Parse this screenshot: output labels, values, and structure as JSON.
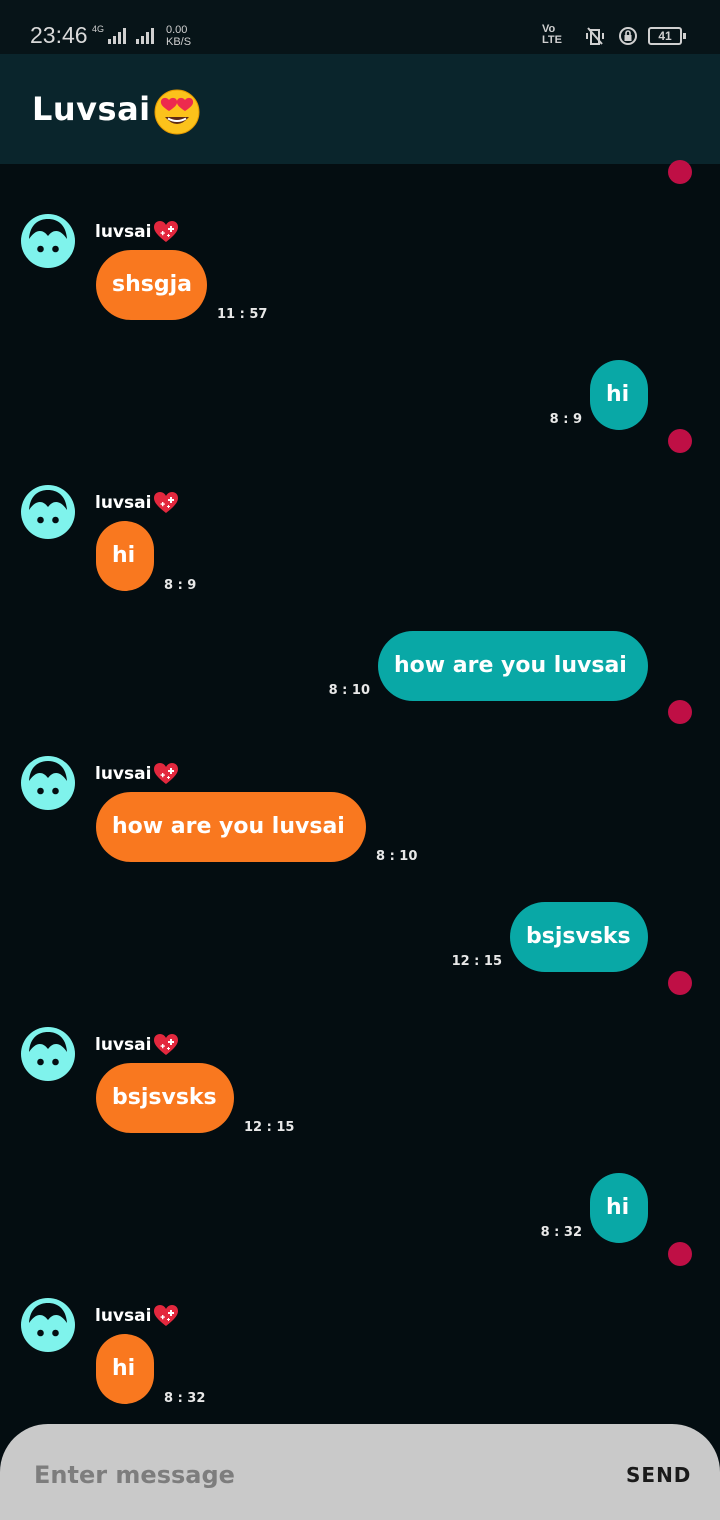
{
  "status_bar": {
    "time": "23:46",
    "network": "4G",
    "speed_value": "0.00",
    "speed_unit": "KB/S",
    "volte_line1": "Vo",
    "volte_line2": "LTE",
    "battery": "41"
  },
  "app_bar": {
    "title": "Luvsai"
  },
  "messages": [
    {
      "direction": "in",
      "sender": "luvsai",
      "text": "shsgja",
      "time": "11 : 57"
    },
    {
      "direction": "out",
      "text": "hi",
      "time": "8 : 9"
    },
    {
      "direction": "in",
      "sender": "luvsai",
      "text": "hi",
      "time": "8 : 9"
    },
    {
      "direction": "out",
      "text": "how are you luvsai",
      "time": "8 : 10"
    },
    {
      "direction": "in",
      "sender": "luvsai",
      "text": "how are you luvsai",
      "time": "8 : 10"
    },
    {
      "direction": "out",
      "text": "bsjsvsks",
      "time": "12 : 15"
    },
    {
      "direction": "in",
      "sender": "luvsai",
      "text": "bsjsvsks",
      "time": "12 : 15"
    },
    {
      "direction": "out",
      "text": "hi",
      "time": "8 : 32"
    },
    {
      "direction": "in",
      "sender": "luvsai",
      "text": "hi",
      "time": "8 : 32"
    }
  ],
  "composer": {
    "placeholder": "Enter message",
    "send_label": "SEND"
  },
  "colors": {
    "incoming_bubble": "#f9781f",
    "outgoing_bubble": "#09a8a6",
    "unread_dot": "#bf0f45",
    "avatar": "#7ff3ec",
    "app_bar": "#0a252c",
    "background": "#040d11"
  }
}
